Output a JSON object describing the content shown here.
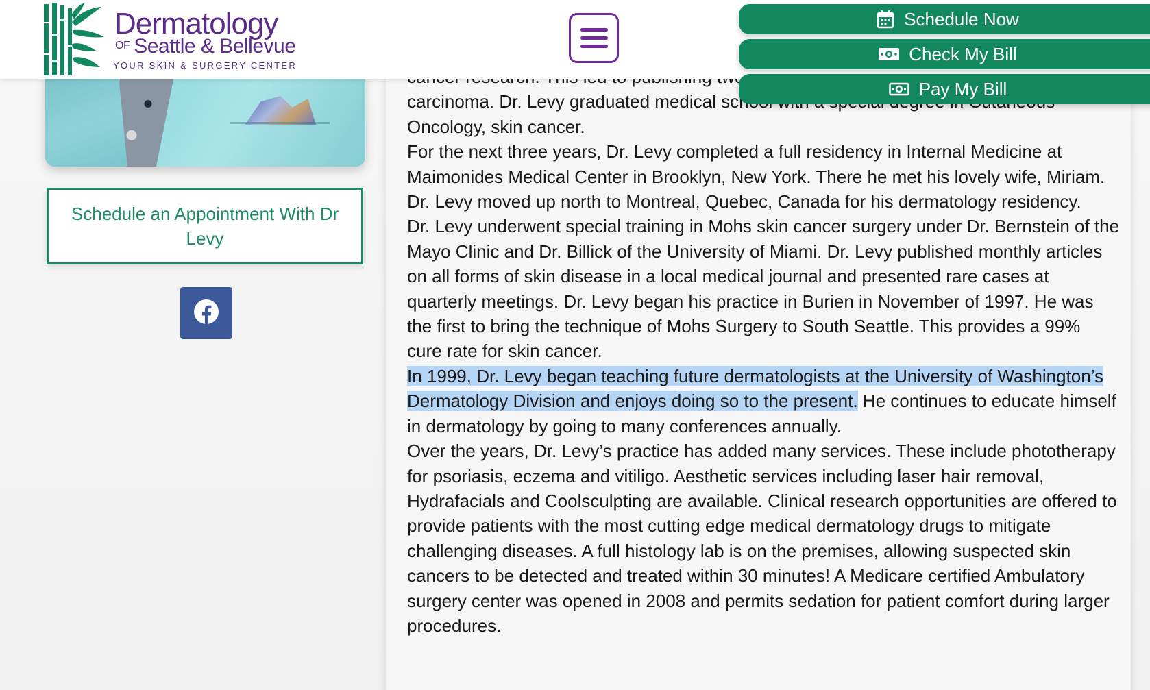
{
  "header": {
    "logo": {
      "title": "Dermatology",
      "of": "OF",
      "subtitle": "Seattle & Bellevue",
      "tagline": "YOUR SKIN & SURGERY CENTER"
    },
    "menu_icon": "hamburger-icon"
  },
  "cta_buttons": [
    {
      "label": "Schedule Now",
      "icon": "calendar-icon"
    },
    {
      "label": "Check My Bill",
      "icon": "money-bill-icon"
    },
    {
      "label": "Pay My Bill",
      "icon": "money-bill-outline-icon"
    }
  ],
  "sidebar": {
    "appointment_button": "Schedule an Appointment With Dr Levy",
    "social": {
      "icon": "facebook-icon"
    }
  },
  "article": {
    "paragraphs": [
      "cancer research. This led to publishing two articles on the treatment of basal cell carcinoma. Dr. Levy graduated medical school with a special degree in Cutaneous Oncology, skin cancer.",
      "For the next three years, Dr. Levy completed a full residency in Internal Medicine at Maimonides Medical Center in Brooklyn, New York. There he met his lovely wife, Miriam.",
      "Dr. Levy moved up north to Montreal, Quebec, Canada for his dermatology residency.",
      "Dr. Levy underwent special training in Mohs skin cancer surgery under Dr. Bernstein of the Mayo Clinic and Dr. Billick of the University of Miami. Dr. Levy published monthly articles on all forms of skin disease in a local medical journal and presented rare cases at quarterly meetings.  Dr. Levy began his practice in Burien in November of 1997. He was the first to bring the technique of Mohs Surgery to South Seattle. This provides a 99% cure rate for skin cancer."
    ],
    "highlighted": "In 1999, Dr. Levy began teaching future dermatologists at the University of Washington’s Dermatology Division and enjoys doing so to the present.",
    "after_highlight": " He continues to educate himself in dermatology by going to many conferences annually.",
    "final_paragraph": "Over the years, Dr. Levy’s practice has added many services. These include phototherapy for psoriasis, eczema and vitiligo. Aesthetic services including laser hair removal, Hydrafacials and Coolsculpting are available. Clinical research opportunities are offered to provide patients with the most cutting edge medical dermatology drugs to mitigate challenging diseases. A full histology lab is on the premises, allowing suspected skin cancers to be detected and treated within 30 minutes! A Medicare certified Ambulatory surgery center was opened in 2008 and permits sedation for patient comfort during larger procedures."
  },
  "colors": {
    "brand_purple": "#5b2d86",
    "brand_green": "#13885e",
    "highlight": "#b6d5f5",
    "facebook_blue": "#3b5998"
  }
}
